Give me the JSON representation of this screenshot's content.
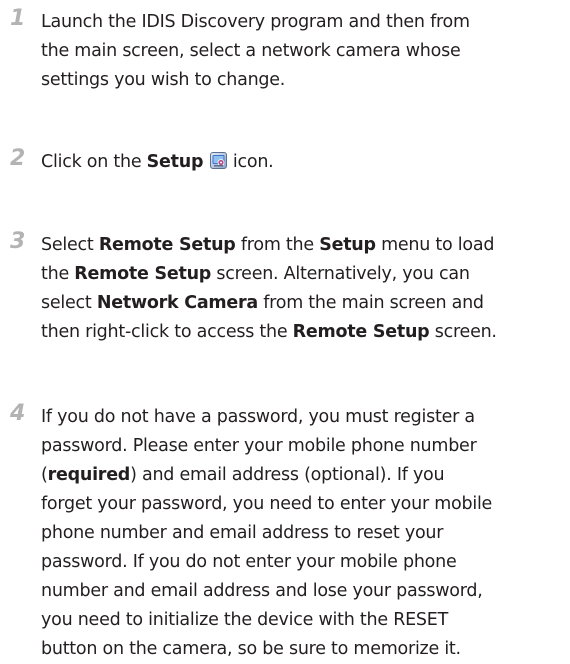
{
  "steps": [
    {
      "number": "1",
      "line_1": "Launch the IDIS Discovery program and then from",
      "line_2": "the main screen, select a network camera whose",
      "line_3": "settings you wish to change."
    },
    {
      "number": "2",
      "prefix": "Click on the ",
      "bold": "Setup",
      "suffix": " icon.",
      "icon": "setup-icon"
    },
    {
      "number": "3",
      "l1_pre": "Select ",
      "l1_b1": "Remote Setup",
      "l1_mid": " from the ",
      "l1_b2": "Setup",
      "l1_post": " menu to load",
      "l2_pre": "the ",
      "l2_b1": "Remote Setup",
      "l2_post": " screen. Alternatively, you can",
      "l3_pre": "select ",
      "l3_b1": "Network Camera",
      "l3_post": " from the main screen and",
      "l4_pre": "then right-click to access the ",
      "l4_b1": "Remote Setup",
      "l4_post": " screen."
    },
    {
      "number": "4",
      "line_1": "If you do not have a password, you must register a",
      "line_2": "password. Please enter your mobile phone number",
      "l3_pre": "(",
      "l3_b1": "required",
      "l3_post": ") and email address (optional). If you",
      "line_4": "forget your password, you need to enter your mobile",
      "line_5": "phone number and email address to reset your",
      "line_6": "password. If you do not enter your mobile phone",
      "line_7": "number and email address and lose your password,",
      "line_8": "you need to initialize the device with the RESET",
      "line_9": "button on the camera, so be sure to memorize it."
    }
  ]
}
